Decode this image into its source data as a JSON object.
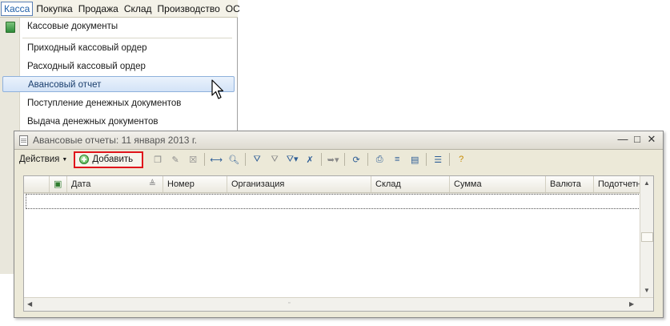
{
  "menubar": {
    "items": [
      "Касса",
      "Покупка",
      "Продажа",
      "Склад",
      "Производство",
      "ОС"
    ]
  },
  "dropdown": {
    "items": [
      "Кассовые документы",
      "Приходный кассовый ордер",
      "Расходный кассовый ордер",
      "Авансовый отчет",
      "Поступление денежных документов",
      "Выдача денежных документов"
    ]
  },
  "window": {
    "title": "Авансовые отчеты: 11 января 2013 г.",
    "buttons": {
      "minimize": "—",
      "maximize": "□",
      "close": "✕"
    }
  },
  "toolbar": {
    "actions_label": "Действия",
    "add_label": "Добавить"
  },
  "grid": {
    "columns": [
      "Дата",
      "Номер",
      "Организация",
      "Склад",
      "Сумма",
      "Валюта",
      "Подотчетн..."
    ]
  },
  "colors": {
    "highlight": "#e0141b",
    "accent": "#1f5fa8"
  }
}
